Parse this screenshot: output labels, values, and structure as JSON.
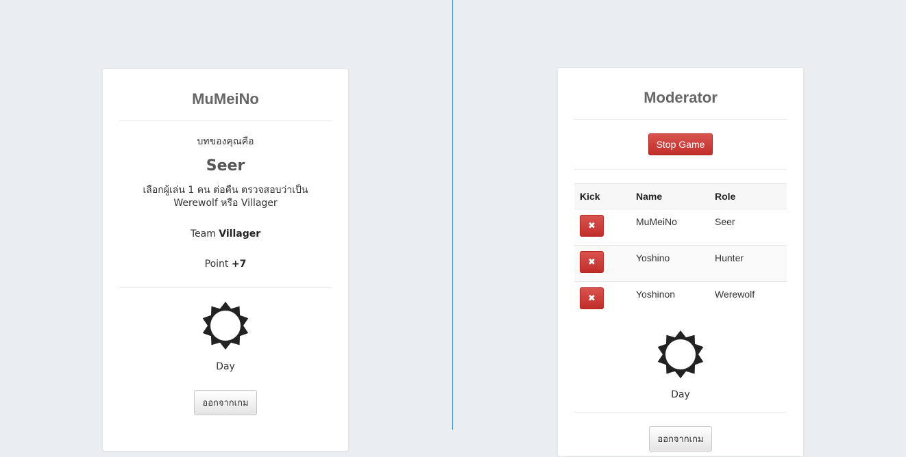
{
  "player_view": {
    "title": "MuMeiNo",
    "role_label": "บทของคุณคือ",
    "role_name": "Seer",
    "role_description": "เลือกผู้เล่น 1 คน ต่อคืน ตรวจสอบว่าเป็น Werewolf หรือ Villager",
    "team_prefix": "Team",
    "team_value": "Villager",
    "point_prefix": "Point",
    "point_value": "+7",
    "phase_icon": "sun-icon",
    "phase_label": "Day",
    "leave_button": "ออกจากเกม"
  },
  "moderator_view": {
    "title": "Moderator",
    "stop_button": "Stop Game",
    "table": {
      "headers": [
        "Kick",
        "Name",
        "Role"
      ],
      "rows": [
        {
          "kick_icon": "close-icon",
          "name": "MuMeiNo",
          "role": "Seer"
        },
        {
          "kick_icon": "close-icon",
          "name": "Yoshino",
          "role": "Hunter"
        },
        {
          "kick_icon": "close-icon",
          "name": "Yoshinon",
          "role": "Werewolf"
        }
      ]
    },
    "phase_icon": "sun-icon",
    "phase_label": "Day",
    "leave_button": "ออกจากเกม"
  },
  "colors": {
    "background": "#ebeef0",
    "danger": "#d9534f",
    "divider": "#2f88d6"
  }
}
